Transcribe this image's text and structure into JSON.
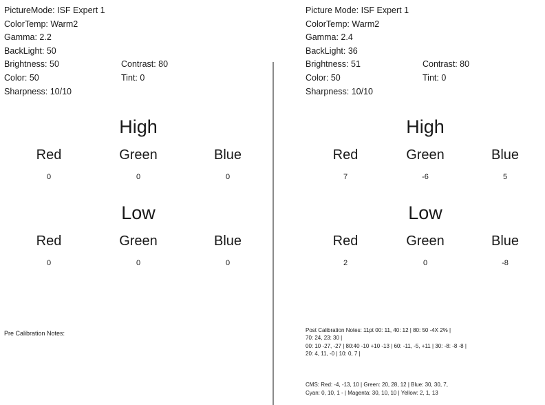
{
  "panels": [
    {
      "id": "pre-calibration",
      "settings": {
        "picture_mode": "PictureMode: ISF Expert 1",
        "color_temp": "ColorTemp: Warm2",
        "gamma": "Gamma: 2.2",
        "backlight": "BackLight: 50",
        "brightness": "Brightness: 50",
        "contrast": "Contrast: 80",
        "color": "Color: 50",
        "tint": "Tint: 0",
        "sharpness": "Sharpness: 10/10"
      },
      "high": {
        "title": "High",
        "labels": [
          "Red",
          "Green",
          "Blue"
        ],
        "values": [
          "0",
          "0",
          "0"
        ]
      },
      "low": {
        "title": "Low",
        "labels": [
          "Red",
          "Green",
          "Blue"
        ],
        "values": [
          "0",
          "0",
          "0"
        ]
      },
      "notes_label": "Pre Calibration Notes:"
    },
    {
      "id": "post-calibration",
      "settings": {
        "picture_mode": "Picture Mode: ISF Expert 1",
        "color_temp": "ColorTemp: Warm2",
        "gamma": "Gamma: 2.4",
        "backlight": "BackLight: 36",
        "brightness": "Brightness: 51",
        "contrast": "Contrast: 80",
        "color": "Color: 50",
        "tint": "Tint: 0",
        "sharpness": "Sharpness: 10/10"
      },
      "high": {
        "title": "High",
        "labels": [
          "Red",
          "Green",
          "Blue"
        ],
        "values": [
          "7",
          "-6",
          "5"
        ]
      },
      "low": {
        "title": "Low",
        "labels": [
          "Red",
          "Green",
          "Blue"
        ],
        "values": [
          "2",
          "0",
          "-8"
        ]
      },
      "notes_label": "Post Calibration Notes:",
      "notes_lines": [
        "Post Calibration Notes: 11pt 00: 11, 40: 12 | 80: 50  -4X  2% |",
        "70: 24, 23: 30 |",
        "00:  10 -27, -27 | 80:40 -10 +10 -13 | 60: -11, -5, +11 | 30: -8: -8 -8 |",
        "20: 4, 11, -0 | 10: 0, 7 |"
      ],
      "cms_lines": [
        "CMS: Red: -4, -13, 10 | Green: 20, 28, 12 | Blue: 30, 30, 7,",
        "Cyan: 0, 10, 1 - | Magenta: 30, 10, 10 | Yellow: 2, 1, 13"
      ]
    }
  ],
  "colors": {
    "text": "#1a1a1a",
    "divider": "#8a8a8a",
    "background": "#ffffff"
  }
}
